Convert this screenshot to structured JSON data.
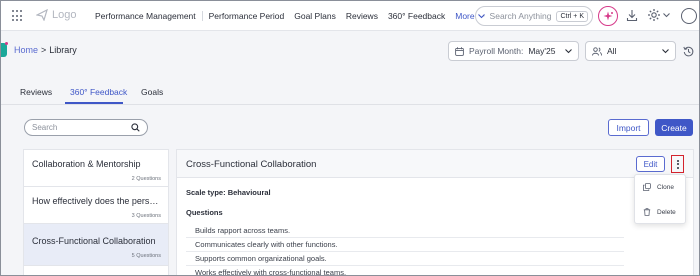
{
  "brand": {
    "logo_text": "Logo"
  },
  "nav": {
    "items": [
      "Performance Management",
      "Performance Period",
      "Goal Plans",
      "Reviews",
      "360° Feedback"
    ],
    "more_label": "More"
  },
  "global_search": {
    "placeholder": "Search Anything",
    "shortcut": "Ctrl + K"
  },
  "breadcrumb": {
    "home": "Home",
    "separator": ">",
    "current": "Library"
  },
  "filters": {
    "payroll_label": "Payroll Month:",
    "payroll_value": "May'25",
    "user_filter_value": "All"
  },
  "tabs": [
    {
      "label": "Reviews",
      "active": false
    },
    {
      "label": "360° Feedback",
      "active": true
    },
    {
      "label": "Goals",
      "active": false
    }
  ],
  "list_search": {
    "placeholder": "Search"
  },
  "actions": {
    "import_label": "Import",
    "create_label": "Create"
  },
  "library_list": [
    {
      "title": "Collaboration & Mentorship",
      "count": "2 Questions",
      "selected": false
    },
    {
      "title": "How effectively does the person...",
      "count": "3 Questions",
      "selected": false
    },
    {
      "title": "Cross-Functional Collaboration",
      "count": "5 Questions",
      "selected": true
    }
  ],
  "detail": {
    "title": "Cross-Functional Collaboration",
    "edit_label": "Edit",
    "scale_label": "Scale type:",
    "scale_value": "Behavioural",
    "questions_heading": "Questions",
    "questions": [
      "Builds rapport across teams.",
      "Communicates clearly with other functions.",
      "Supports common organizational goals.",
      "Works effectively with cross-functional teams."
    ]
  },
  "row_menu": {
    "clone_label": "Clone",
    "delete_label": "Delete"
  },
  "colors": {
    "accent": "#3f57c7",
    "highlight_border": "#d4232d",
    "ai_pink": "#d63a8a",
    "selected_bg": "#e8ecf7"
  }
}
